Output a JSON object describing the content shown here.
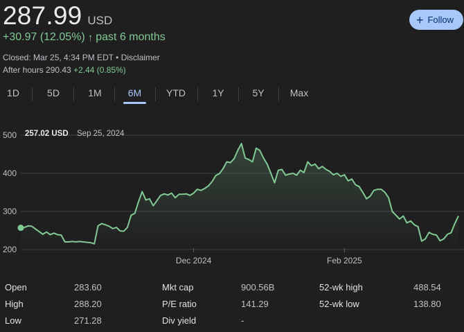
{
  "quote": {
    "price": "287.99",
    "currency": "USD",
    "change_text": "+30.97 (12.05%)",
    "change_arrow": "↑",
    "period_text": "past 6 months",
    "closed_text": "Closed: Mar 25, 4:34 PM EDT • Disclaimer",
    "after_hours_label": "After hours 290.43",
    "after_hours_change": "+2.44 (0.85%)",
    "follow_label": "Follow",
    "follow_icon": "plus-icon"
  },
  "colors": {
    "accent": "#a8c7fa",
    "line": "#81c995",
    "background": "#1f1f1f"
  },
  "tabs": [
    {
      "label": "1D"
    },
    {
      "label": "5D"
    },
    {
      "label": "1M"
    },
    {
      "label": "6M",
      "active": true
    },
    {
      "label": "YTD"
    },
    {
      "label": "1Y"
    },
    {
      "label": "5Y"
    },
    {
      "label": "Max"
    }
  ],
  "chart_data": {
    "type": "area",
    "hover": {
      "value": "257.02 USD",
      "date": "Sep 25, 2024"
    },
    "y_ticks": [
      "500",
      "400",
      "300",
      "200"
    ],
    "ylim": [
      200,
      500
    ],
    "x_ticks": [
      {
        "label": "Dec 2024",
        "index": 47
      },
      {
        "label": "Feb 2025",
        "index": 88
      }
    ],
    "grid": true,
    "values": [
      257,
      258,
      262,
      261,
      254,
      247,
      240,
      246,
      239,
      243,
      239,
      238,
      220,
      220,
      221,
      220,
      221,
      220,
      219,
      218,
      215,
      262,
      268,
      265,
      261,
      255,
      258,
      249,
      248,
      258,
      290,
      295,
      325,
      352,
      330,
      333,
      315,
      328,
      342,
      346,
      343,
      348,
      336,
      345,
      345,
      346,
      342,
      348,
      358,
      355,
      360,
      367,
      378,
      394,
      399,
      412,
      430,
      428,
      438,
      460,
      478,
      440,
      436,
      430,
      466,
      460,
      440,
      424,
      400,
      375,
      408,
      410,
      395,
      398,
      400,
      395,
      408,
      402,
      430,
      420,
      424,
      412,
      418,
      410,
      405,
      396,
      400,
      392,
      396,
      380,
      385,
      370,
      365,
      350,
      333,
      340,
      355,
      358,
      358,
      350,
      336,
      300,
      290,
      280,
      288,
      270,
      275,
      265,
      260,
      222,
      228,
      245,
      240,
      238,
      223,
      228,
      240,
      244,
      268,
      288
    ]
  },
  "stats": [
    [
      {
        "label": "Open",
        "value": "283.60"
      },
      {
        "label": "Mkt cap",
        "value": "900.56B"
      },
      {
        "label": "52-wk high",
        "value": "488.54"
      }
    ],
    [
      {
        "label": "High",
        "value": "288.20"
      },
      {
        "label": "P/E ratio",
        "value": "141.29"
      },
      {
        "label": "52-wk low",
        "value": "138.80"
      }
    ],
    [
      {
        "label": "Low",
        "value": "271.28"
      },
      {
        "label": "Div yield",
        "value": "-"
      }
    ]
  ]
}
